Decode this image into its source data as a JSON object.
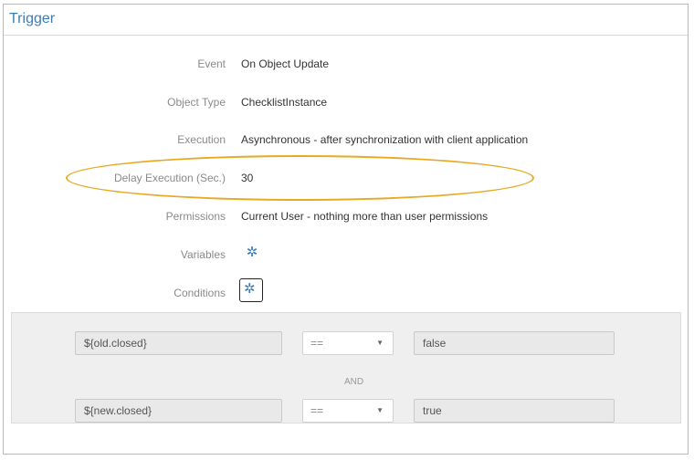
{
  "header": {
    "title": "Trigger"
  },
  "fields": {
    "event": {
      "label": "Event",
      "value": "On Object Update"
    },
    "object_type": {
      "label": "Object Type",
      "value": "ChecklistInstance"
    },
    "execution": {
      "label": "Execution",
      "value": "Asynchronous - after synchronization with client application"
    },
    "delay": {
      "label": "Delay Execution (Sec.)",
      "value": "30"
    },
    "permissions": {
      "label": "Permissions",
      "value": "Current User - nothing more than user permissions"
    },
    "variables": {
      "label": "Variables",
      "icon": "gear-icon"
    },
    "conditions": {
      "label": "Conditions",
      "icon": "gear-icon"
    }
  },
  "condition_rows": [
    {
      "left": "${old.closed}",
      "operator": "==",
      "right": "false"
    },
    {
      "left": "${new.closed}",
      "operator": "==",
      "right": "true"
    }
  ],
  "conjunction": "AND",
  "colors": {
    "accent": "#3c7eb4",
    "highlight": "#e8a923"
  }
}
